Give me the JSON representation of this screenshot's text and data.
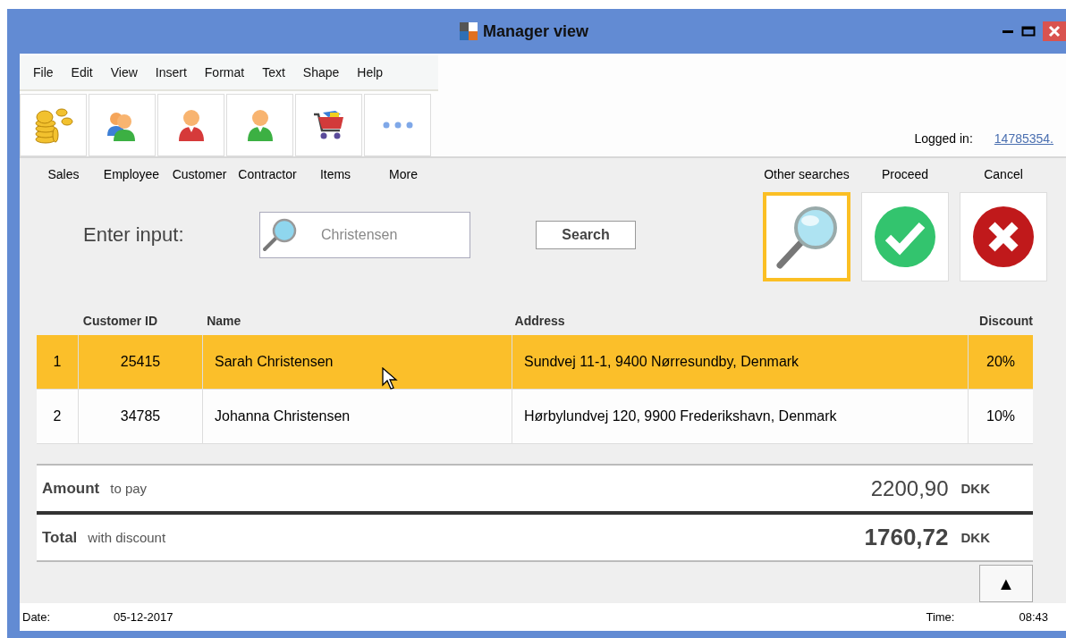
{
  "window": {
    "title": "Manager view"
  },
  "menu": [
    "File",
    "Edit",
    "View",
    "Insert",
    "Format",
    "Text",
    "Shape",
    "Help"
  ],
  "tools": [
    {
      "kind": "coins",
      "label": "Sales"
    },
    {
      "kind": "people",
      "label": "Employee"
    },
    {
      "kind": "customer",
      "label": "Customer"
    },
    {
      "kind": "contractor",
      "label": "Contractor"
    },
    {
      "kind": "cart",
      "label": "Items"
    },
    {
      "kind": "more",
      "label": "More"
    }
  ],
  "login": {
    "label": "Logged in:",
    "user": "14785354."
  },
  "search": {
    "label": "Enter input:",
    "placeholder": "Christensen",
    "button": "Search"
  },
  "actions": [
    {
      "kind": "search",
      "label": "Other searches",
      "selected": true
    },
    {
      "kind": "proceed",
      "label": "Proceed",
      "selected": false
    },
    {
      "kind": "cancel",
      "label": "Cancel",
      "selected": false
    }
  ],
  "table": {
    "columns": [
      "Customer ID",
      "Name",
      "Address",
      "Discount"
    ],
    "rows": [
      {
        "number": "1",
        "customer_id": "25415",
        "name": "Sarah Christensen",
        "address": "Sundvej 11-1, 9400 Nørresundby, Denmark",
        "discount": "20%",
        "selected": true
      },
      {
        "number": "2",
        "customer_id": "34785",
        "name": "Johanna Christensen",
        "address": "Hørbylundvej 120, 9900 Frederikshavn, Denmark",
        "discount": "10%",
        "selected": false
      }
    ]
  },
  "totals": [
    {
      "kind": "amount",
      "label": "Amount",
      "note": "to pay",
      "value": "2200,90",
      "currency": "DKK"
    },
    {
      "kind": "total",
      "label": "Total",
      "note": "with discount",
      "value": "1760,72",
      "currency": "DKK"
    }
  ],
  "up_button": "▲",
  "status_bar": {
    "date_label": "Date:",
    "date": "05-12-2017",
    "time_label": "Time:",
    "time": "08:43"
  }
}
